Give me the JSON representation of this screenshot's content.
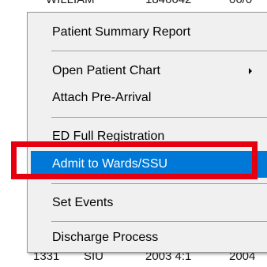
{
  "background": {
    "top_row": [
      "WILLIAM",
      "1846642",
      "06/0"
    ],
    "bottom_row": [
      "1331",
      "SIU",
      "2003 4:1",
      "2004"
    ]
  },
  "menu": {
    "items": [
      {
        "label": "Patient Summary Report"
      },
      {
        "label": "Open Patient Chart",
        "has_submenu": true
      },
      {
        "label": "Attach Pre-Arrival"
      },
      {
        "label": "ED Full Registration"
      },
      {
        "label": "Admit to Wards/SSU",
        "selected": true
      },
      {
        "label": "Set Events"
      },
      {
        "label": "Discharge Process"
      }
    ]
  },
  "colors": {
    "selection": "#0078d7",
    "highlight_box": "#e6000f",
    "menu_background": "#f0f0f0"
  }
}
